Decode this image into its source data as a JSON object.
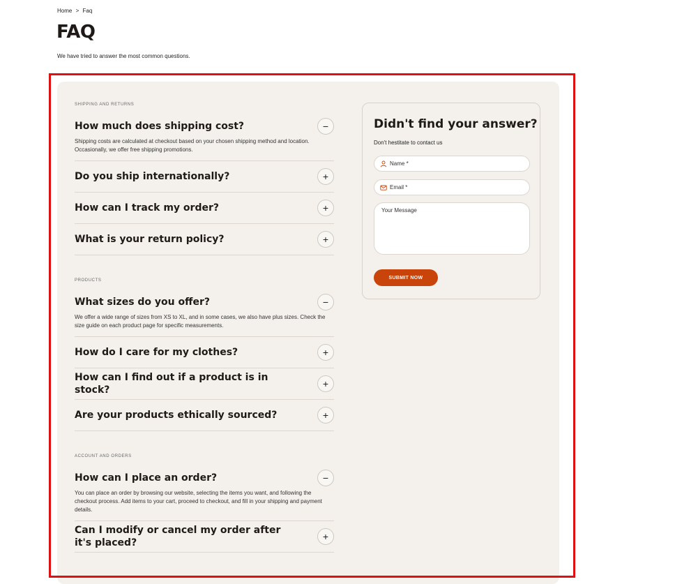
{
  "breadcrumb": {
    "home": "Home",
    "separator": ">",
    "current": "Faq"
  },
  "page": {
    "title": "FAQ",
    "subtitle": "We have tried to answer the most common questions."
  },
  "sections": [
    {
      "label": "SHIPPING AND RETURNS",
      "items": [
        {
          "question": "How much does shipping cost?",
          "toggle": "−",
          "answer": "Shipping costs are calculated at checkout based on your chosen shipping method and location. Occasionally, we offer free shipping promotions."
        },
        {
          "question": "Do you ship internationally?",
          "toggle": "+"
        },
        {
          "question": "How can I track my order?",
          "toggle": "+"
        },
        {
          "question": "What is your return policy?",
          "toggle": "+"
        }
      ]
    },
    {
      "label": "PRODUCTS",
      "items": [
        {
          "question": "What sizes do you offer?",
          "toggle": "−",
          "answer": "We offer a wide range of sizes from XS to XL, and in some cases, we also have plus sizes. Check the size guide on each product page for specific measurements."
        },
        {
          "question": "How do I care for my clothes?",
          "toggle": "+"
        },
        {
          "question": "How can I find out if a product is in stock?",
          "toggle": "+"
        },
        {
          "question": "Are your products ethically sourced?",
          "toggle": "+"
        }
      ]
    },
    {
      "label": "ACCOUNT AND ORDERS",
      "items": [
        {
          "question": "How can I place an order?",
          "toggle": "−",
          "answer": "You can place an order by browsing our website, selecting the items you want, and following the checkout process. Add items to your cart, proceed to checkout, and fill in your shipping and payment details."
        },
        {
          "question": "Can I modify or cancel my order after it's placed?",
          "toggle": "+"
        }
      ]
    }
  ],
  "contact": {
    "title": "Didn't find your answer?",
    "subtitle": "Don't hestitate to contact us",
    "name_placeholder": "Name *",
    "email_placeholder": "Email *",
    "message_placeholder": "Your Message",
    "submit_label": "SUBMIT NOW",
    "icon_name": "user-icon",
    "icon_email": "mail-icon"
  },
  "colors": {
    "accent": "#c8440a",
    "panel": "#f4f1ec",
    "highlight": "#e01010"
  }
}
